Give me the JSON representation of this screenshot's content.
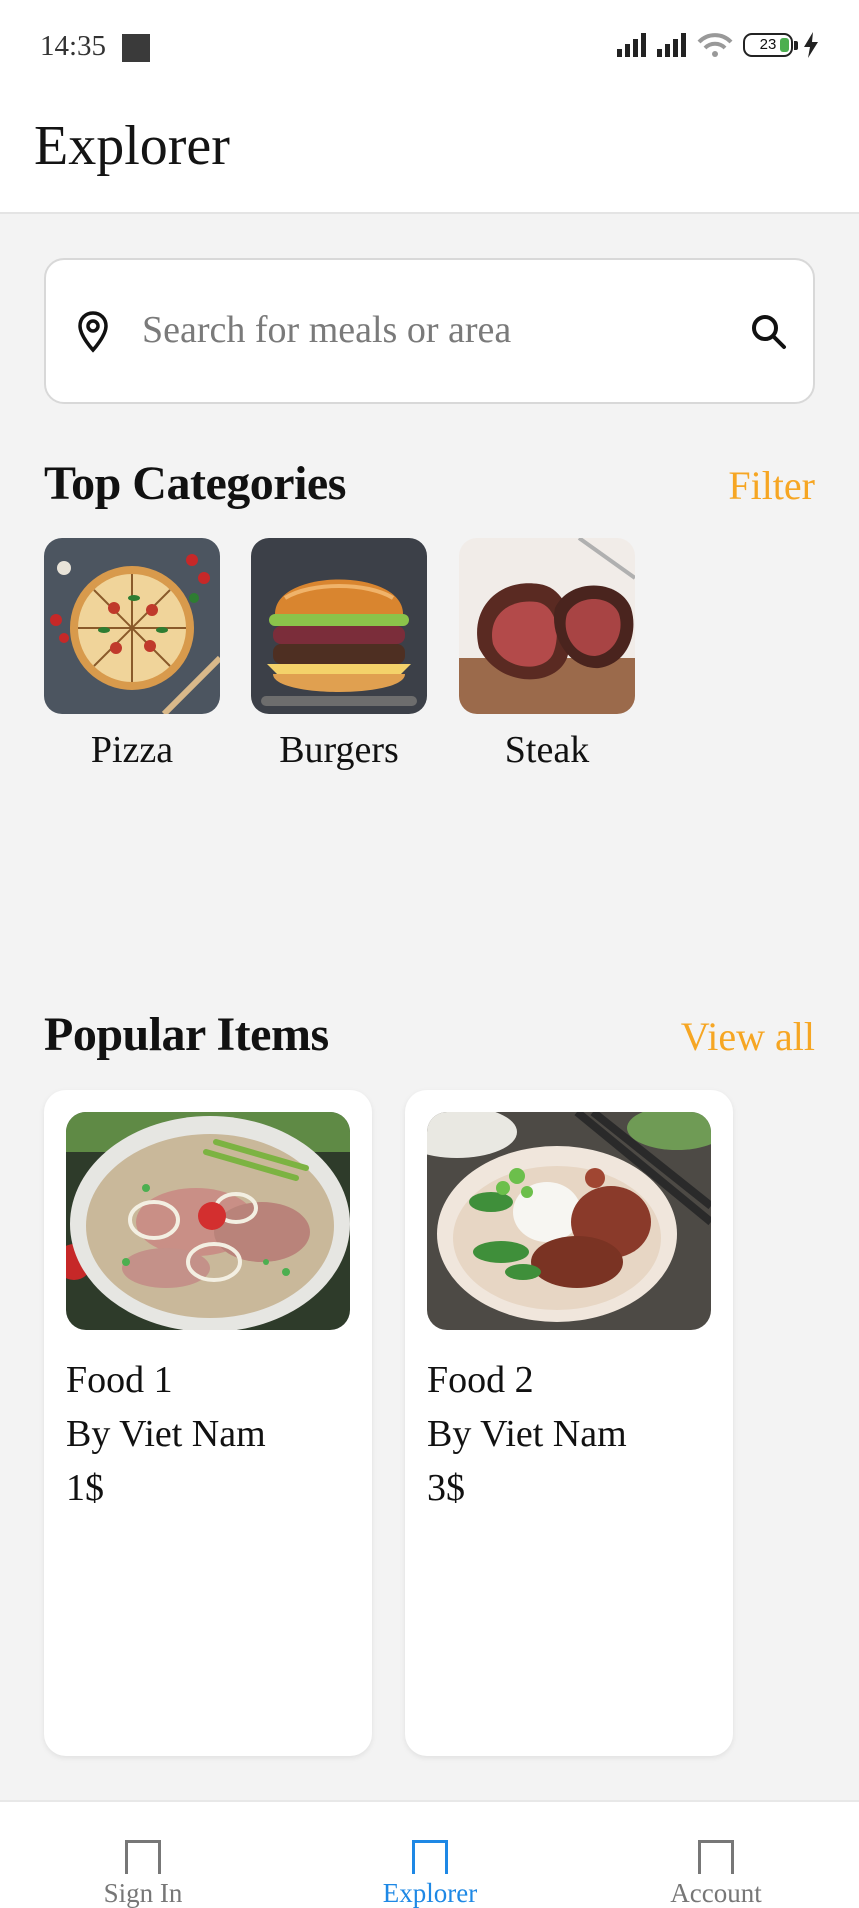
{
  "status_bar": {
    "time": "14:35",
    "battery": "23",
    "icons": [
      "signal-icon",
      "signal-icon",
      "wifi-icon",
      "battery-icon",
      "charging-icon"
    ]
  },
  "header": {
    "title": "Explorer"
  },
  "search": {
    "placeholder": "Search for meals or area",
    "leading_icon": "location-pin-icon",
    "trailing_icon": "search-icon"
  },
  "categories": {
    "title": "Top Categories",
    "action": "Filter",
    "items": [
      {
        "label": "Pizza"
      },
      {
        "label": "Burgers"
      },
      {
        "label": "Steak"
      }
    ]
  },
  "popular": {
    "title": "Popular Items",
    "action": "View all",
    "items": [
      {
        "name": "Food 1",
        "by": "By Viet Nam",
        "price": "1$"
      },
      {
        "name": "Food 2",
        "by": "By Viet Nam",
        "price": "3$"
      }
    ]
  },
  "nav": {
    "items": [
      {
        "label": "Sign In",
        "active": false
      },
      {
        "label": "Explorer",
        "active": true
      },
      {
        "label": "Account",
        "active": false
      }
    ]
  },
  "colors": {
    "accent": "#f6a623",
    "nav_active": "#1e88e5",
    "background": "#f3f3f3"
  }
}
